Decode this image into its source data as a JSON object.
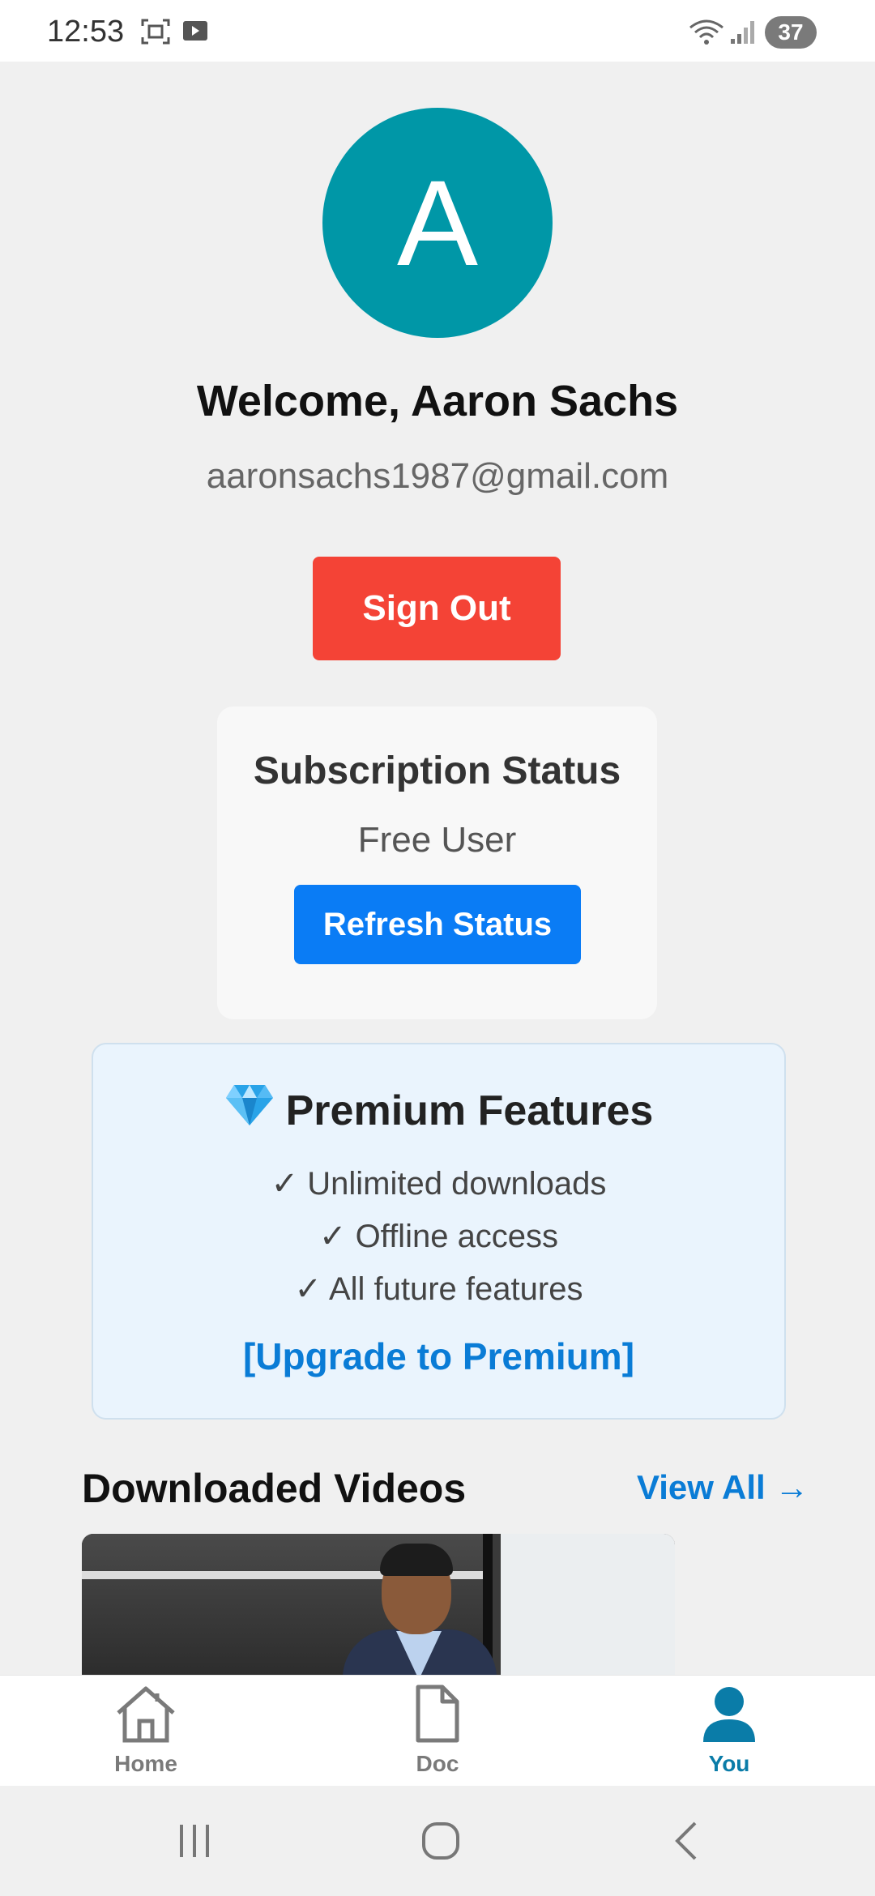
{
  "status_bar": {
    "time": "12:53",
    "battery": "37",
    "icons": [
      "screenshot-icon",
      "media-icon",
      "wifi-icon",
      "signal-icon",
      "battery-icon"
    ]
  },
  "profile": {
    "avatar_letter": "A",
    "avatar_color": "#0097a7",
    "welcome": "Welcome, Aaron Sachs",
    "email": "aaronsachs1987@gmail.com",
    "sign_out_label": "Sign Out",
    "sign_out_color": "#f44336"
  },
  "subscription": {
    "title": "Subscription Status",
    "status": "Free User",
    "refresh_label": "Refresh Status",
    "refresh_color": "#0a7cf5"
  },
  "premium": {
    "icon": "gem-icon",
    "title": "Premium Features",
    "features": [
      "✓ Unlimited downloads",
      "✓ Offline access",
      "✓ All future features"
    ],
    "upgrade_label": "[Upgrade to Premium]",
    "accent_color": "#0a7cd6"
  },
  "downloads": {
    "title": "Downloaded Videos",
    "view_all_label": "View All →"
  },
  "bottom_nav": {
    "items": [
      {
        "label": "Home",
        "icon": "home-icon",
        "active": false
      },
      {
        "label": "Doc",
        "icon": "document-icon",
        "active": false
      },
      {
        "label": "You",
        "icon": "person-icon",
        "active": true
      }
    ],
    "active_color": "#0a7ca8",
    "inactive_color": "#7a7a7a"
  },
  "system_nav": {
    "buttons": [
      "recents-icon",
      "home-circle-icon",
      "back-icon"
    ]
  }
}
